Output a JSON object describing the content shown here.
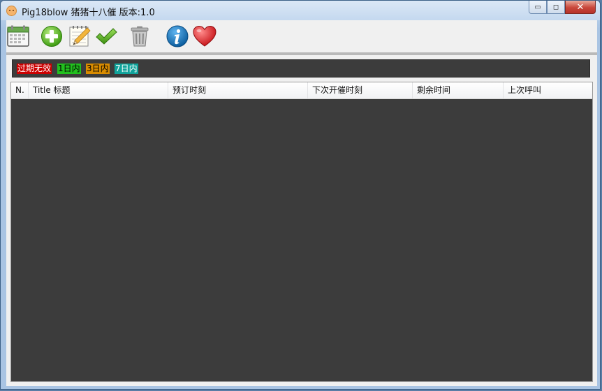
{
  "window": {
    "title": "Pig18blow 猪猪十八催 版本:1.0",
    "minimize_glyph": "▭",
    "maximize_glyph": "◻",
    "close_glyph": "✕"
  },
  "toolbar": {
    "buttons": [
      {
        "name": "calendar",
        "icon": "calendar-icon"
      },
      {
        "name": "add",
        "icon": "plus-circle-icon"
      },
      {
        "name": "edit",
        "icon": "pencil-notepad-icon"
      },
      {
        "name": "done",
        "icon": "checkmark-icon"
      },
      {
        "name": "delete",
        "icon": "trash-icon"
      },
      {
        "name": "info",
        "icon": "info-icon"
      },
      {
        "name": "favorite",
        "icon": "heart-icon"
      }
    ]
  },
  "legend": {
    "items": [
      {
        "label": "过期无效",
        "bg": "#cc0000",
        "fg": "#ffffff"
      },
      {
        "label": "1日内",
        "bg": "#22c01e",
        "fg": "#000000"
      },
      {
        "label": "3日内",
        "bg": "#d98c00",
        "fg": "#000000"
      },
      {
        "label": "7日内",
        "bg": "#10a39b",
        "fg": "#ffffff"
      }
    ]
  },
  "table": {
    "columns": [
      "N.",
      "Title 标题",
      "预订时刻",
      "下次开催时刻",
      "剩余时间",
      "上次呼叫"
    ],
    "rows": []
  },
  "colors": {
    "list_background": "#3c3c3c",
    "accent_blue": "#1f6fb2",
    "heart_red": "#d9181e"
  }
}
